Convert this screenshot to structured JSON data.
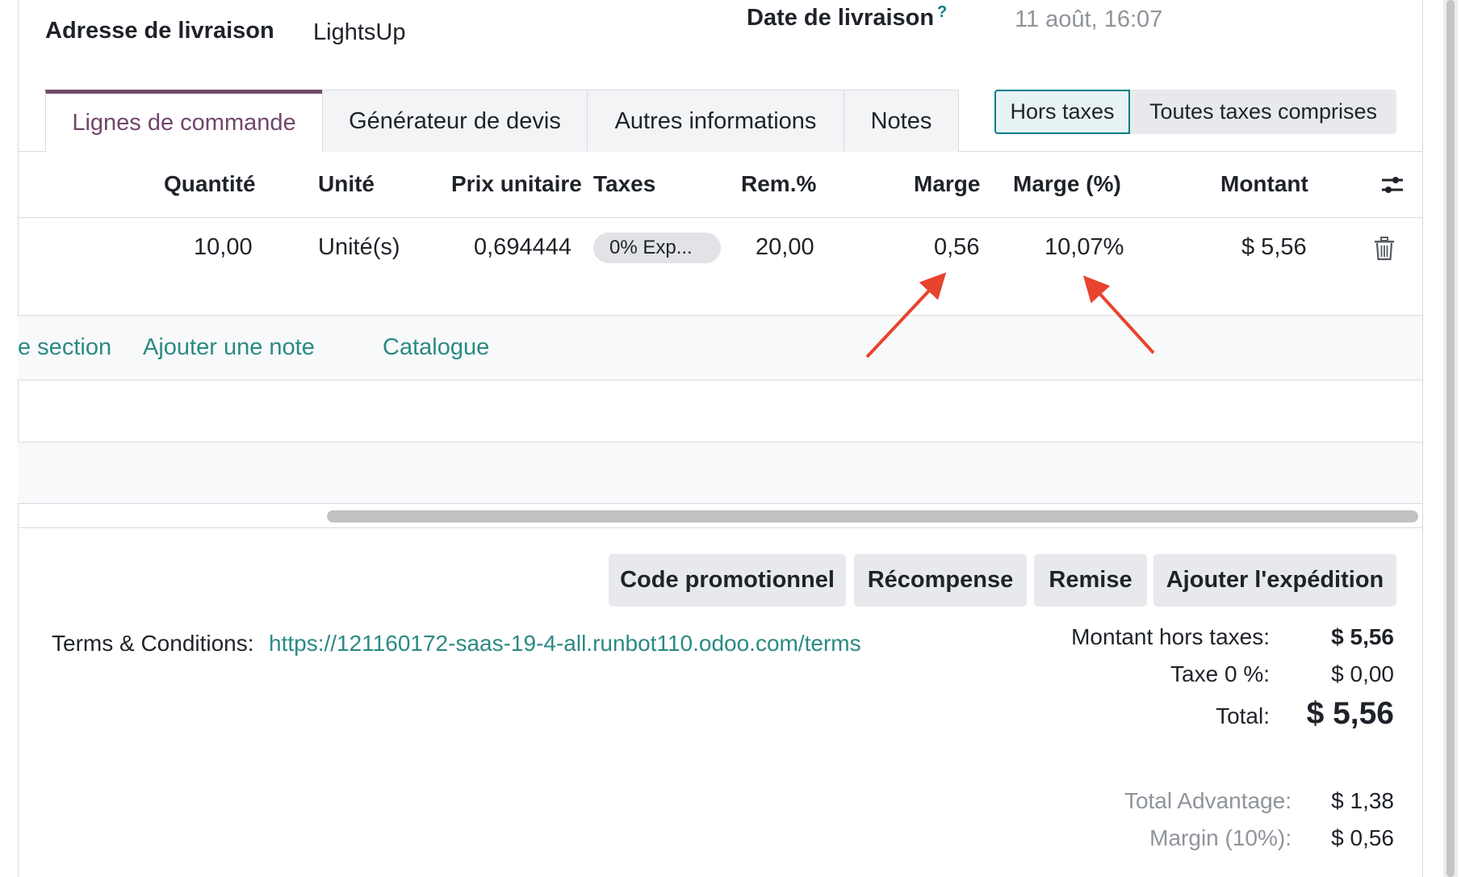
{
  "header": {
    "delivery_address_label": "Adresse de livraison",
    "delivery_address_value": "LightsUp",
    "delivery_date_label": "Date de livraison",
    "help_mark": "?",
    "delivery_date_value": "11 août, 16:07"
  },
  "tabs": [
    {
      "label": "Lignes de commande",
      "active": true
    },
    {
      "label": "Générateur de devis",
      "active": false
    },
    {
      "label": "Autres informations",
      "active": false
    },
    {
      "label": "Notes",
      "active": false
    }
  ],
  "tax_display": {
    "excluded_label": "Hors taxes",
    "included_label": "Toutes taxes comprises",
    "selected": "Hors taxes"
  },
  "table": {
    "columns": [
      "Quantité",
      "Unité",
      "Prix unitaire",
      "Taxes",
      "Rem.%",
      "Marge",
      "Marge (%)",
      "Montant"
    ],
    "rows": [
      {
        "quantity": "10,00",
        "unit": "Unité(s)",
        "unit_price": "0,694444",
        "taxes": "0% Exp...",
        "discount": "20,00",
        "margin": "0,56",
        "margin_pct": "10,07%",
        "amount": "$ 5,56"
      }
    ],
    "settings_icon": "sliders-icon",
    "delete_icon": "trash-icon"
  },
  "add_links": {
    "section": "e section",
    "note": "Ajouter une note",
    "catalog": "Catalogue"
  },
  "buttons": {
    "promo": "Code promotionnel",
    "reward": "Récompense",
    "discount": "Remise",
    "shipping": "Ajouter l'expédition"
  },
  "terms": {
    "label": "Terms & Conditions:",
    "url": "https://121160172-saas-19-4-all.runbot110.odoo.com/terms"
  },
  "totals": {
    "untaxed_label": "Montant hors taxes:",
    "untaxed_value": "$ 5,56",
    "tax_label": "Taxe 0 %:",
    "tax_value": "$ 0,00",
    "total_label": "Total:",
    "total_value": "$ 5,56",
    "advantage_label": "Total Advantage:",
    "advantage_value": "$ 1,38",
    "margin_label": "Margin (10%):",
    "margin_value": "$ 0,56"
  },
  "annotation": {
    "arrow_color": "#e8432e"
  },
  "colors": {
    "accent": "#714b67",
    "link": "#2b8a83",
    "toggle_border": "#017e84"
  }
}
